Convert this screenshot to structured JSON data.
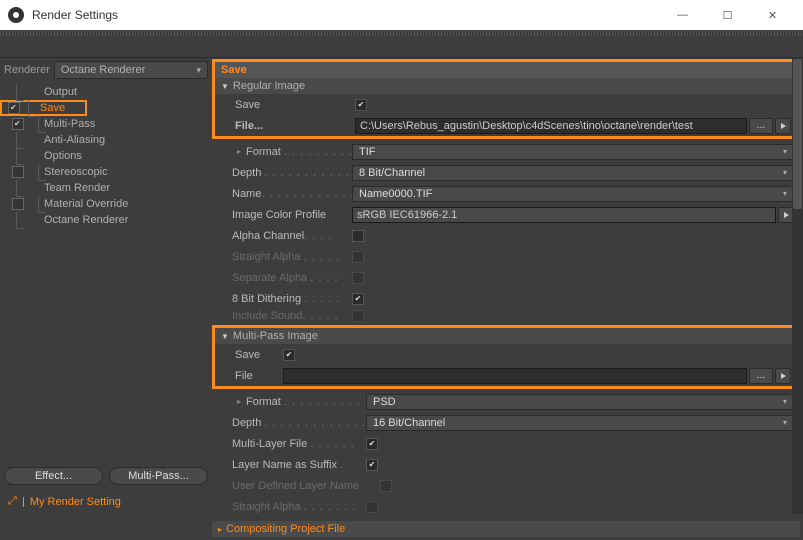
{
  "window": {
    "title": "Render Settings"
  },
  "sidebar": {
    "rendererLabel": "Renderer",
    "rendererValue": "Octane Renderer",
    "items": [
      {
        "label": "Output",
        "checked": false,
        "selected": false
      },
      {
        "label": "Save",
        "checked": true,
        "selected": true
      },
      {
        "label": "Multi-Pass",
        "checked": true,
        "selected": false
      },
      {
        "label": "Anti-Aliasing",
        "checked": false,
        "selected": false
      },
      {
        "label": "Options",
        "checked": false,
        "selected": false
      },
      {
        "label": "Stereoscopic",
        "checked": false,
        "selected": false,
        "checkbox": true
      },
      {
        "label": "Team Render",
        "checked": false,
        "selected": false
      },
      {
        "label": "Material Override",
        "checked": false,
        "selected": false,
        "checkbox": true
      },
      {
        "label": "Octane Renderer",
        "checked": false,
        "selected": false
      }
    ],
    "effectBtn": "Effect...",
    "multipassBtn": "Multi-Pass...",
    "renderSettingLabel": "My Render Setting"
  },
  "content": {
    "headerSave": "Save",
    "regularImage": {
      "title": "Regular Image",
      "saveLabel": "Save",
      "fileLabel": "File...",
      "filePath": "C:\\Users\\Rebus_agustin\\Desktop\\c4dScenes\\tino\\octane\\render\\test",
      "formatLabel": "Format",
      "formatValue": "TIF",
      "depthLabel": "Depth",
      "depthValue": "8 Bit/Channel",
      "nameLabel": "Name",
      "nameValue": "Name0000.TIF",
      "icpLabel": "Image Color Profile",
      "icpValue": "sRGB IEC61966-2.1",
      "alphaLabel": "Alpha Channel",
      "straightLabel": "Straight Alpha",
      "sepAlphaLabel": "Separate Alpha",
      "ditherLabel": "8 Bit Dithering",
      "soundLabel": "Include Sound"
    },
    "multiPassImage": {
      "title": "Multi-Pass Image",
      "saveLabel": "Save",
      "fileLabel": "File",
      "filePath": "",
      "formatLabel": "Format",
      "formatValue": "PSD",
      "depthLabel": "Depth",
      "depthValue": "16 Bit/Channel",
      "multiLayerLabel": "Multi-Layer File",
      "layerNameLabel": "Layer Name as Suffix",
      "userLayerLabel": "User Defined Layer Name",
      "straightLabel": "Straight Alpha"
    },
    "compositing": {
      "title": "Compositing Project File"
    }
  }
}
